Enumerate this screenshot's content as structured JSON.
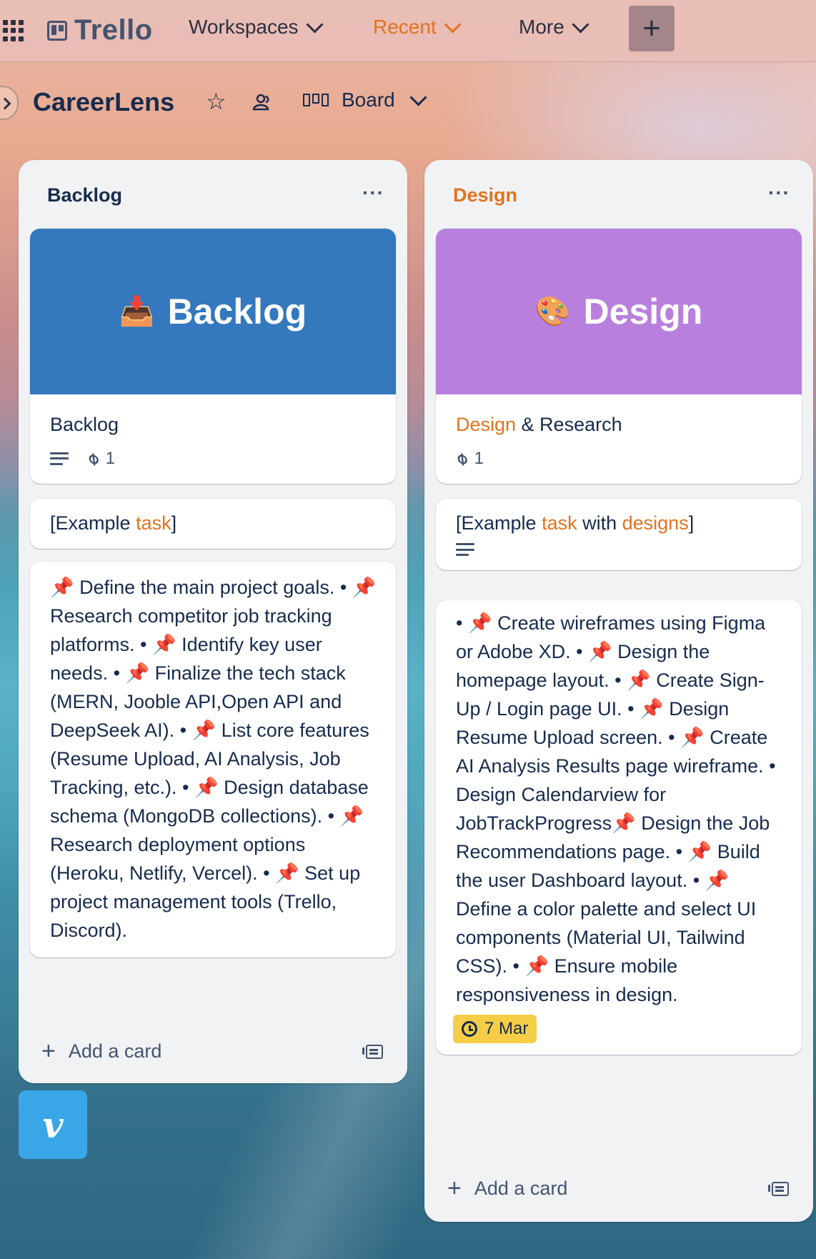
{
  "topbar": {
    "logo_text": "Trello",
    "nav": [
      {
        "label": "Workspaces"
      },
      {
        "label": "Recent"
      },
      {
        "label": "More"
      }
    ],
    "create_symbol": "+"
  },
  "board": {
    "title": "CareerLens",
    "view_label": "Board"
  },
  "lists": [
    {
      "title": "Backlog",
      "menu": "···",
      "cover_text": "Backlog",
      "cover_emoji": "📥",
      "cover_color": "#3478bd",
      "card1_title": "Backlog",
      "card1_attachments": "1",
      "card2_prefix": "[Example ",
      "card2_hl1": "task",
      "card2_suffix": "]",
      "card3_text": "📌 Define the main project goals. • 📌 Research competitor job tracking platforms. • 📌 Identify key user needs. • 📌 Finalize the tech stack (MERN, Jooble API,Open API and DeepSeek AI). • 📌 List core features (Resume Upload, AI Analysis, Job Tracking, etc.). • 📌 Design database schema (MongoDB collections). • 📌 Research deployment options (Heroku, Netlify, Vercel). • 📌 Set up project management tools (Trello, Discord).",
      "add_card": "Add a card"
    },
    {
      "title": "Design",
      "menu": "···",
      "cover_text": "Design",
      "cover_emoji": "🎨",
      "cover_color": "#b97fdd",
      "card1_title_hl": "Design",
      "card1_title_rest": " & Research",
      "card1_attachments": "1",
      "card2_prefix": "[Example ",
      "card2_hl1": "task",
      "card2_mid": " with ",
      "card2_hl2": "designs",
      "card2_suffix": "]",
      "card3_text": "• 📌 Create wireframes using Figma or Adobe XD. • 📌 Design the homepage layout. • 📌 Create Sign-Up / Login page UI. • 📌 Design Resume Upload screen. • 📌 Create AI Analysis Results page wireframe. • Design Calendarview for JobTrackProgress📌 Design the Job Recommendations page. • 📌 Build the user Dashboard layout. • 📌 Define a color palette and select UI components (Material UI, Tailwind CSS). • 📌 Ensure mobile responsiveness in design.",
      "card3_due": "7 Mar",
      "add_card": "Add a card"
    }
  ],
  "floating": {
    "vimeo_glyph": "v"
  },
  "colors": {
    "accent_orange": "#e2731e",
    "due_yellow": "#f5cd47",
    "vimeo_blue": "#39a6e8"
  }
}
